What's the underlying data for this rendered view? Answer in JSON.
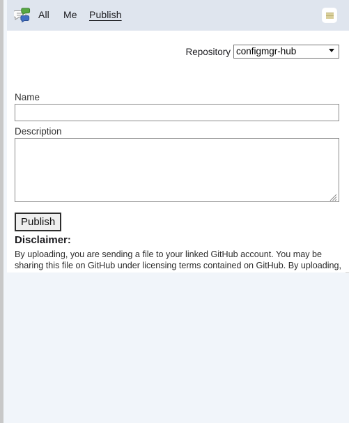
{
  "topbar": {
    "brand_icon": "chat-bubbles-icon",
    "nav": [
      {
        "id": "all",
        "label": "All",
        "active": false
      },
      {
        "id": "me",
        "label": "Me",
        "active": false
      },
      {
        "id": "publish",
        "label": "Publish",
        "active": true
      }
    ],
    "menu_button_icon": "list-menu-icon",
    "background_color": "#dfe5ee"
  },
  "form": {
    "repository": {
      "label": "Repository",
      "selected": "configmgr-hub",
      "options": [
        "configmgr-hub"
      ]
    },
    "name": {
      "label": "Name",
      "value": "",
      "placeholder": ""
    },
    "description": {
      "label": "Description",
      "value": "",
      "placeholder": ""
    },
    "publish_button": "Publish"
  },
  "disclaimer": {
    "heading": "Disclaimer:",
    "body": "By uploading, you are sending a file to your linked GitHub account. You may be sharing this file on GitHub under licensing terms contained on GitHub. By uploading, you represent that you have sufficient rights to the uploaded work to send this file to GitHub and, if applicable, share it under license terms contained on GitHub."
  },
  "colors": {
    "header_bg": "#dfe5ee",
    "panel_bg": "#ffffff",
    "bottom_pane_bg": "#f1f5fa",
    "frame_rail": "#c8c8c8",
    "input_border": "#8a8a8a",
    "button_border": "#2d2d2d"
  }
}
